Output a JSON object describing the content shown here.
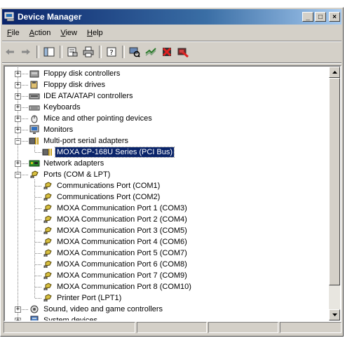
{
  "window": {
    "title": "Device Manager",
    "minimize_label": "_",
    "maximize_label": "□",
    "close_label": "×"
  },
  "menu": [
    {
      "key": "F",
      "rest": "ile"
    },
    {
      "key": "A",
      "rest": "ction"
    },
    {
      "key": "V",
      "rest": "iew"
    },
    {
      "key": "H",
      "rest": "elp"
    }
  ],
  "toolbar": {
    "icons": [
      "back-arrow-icon",
      "forward-arrow-icon",
      "show-hide-console-tree-icon",
      "properties-icon",
      "print-icon",
      "help-icon",
      "scan-hardware-icon",
      "update-driver-icon",
      "uninstall-icon",
      "disable-icon"
    ]
  },
  "tree": {
    "items": [
      {
        "label": "Floppy disk controllers",
        "icon": "floppy-controller-icon",
        "expander": "+"
      },
      {
        "label": "Floppy disk drives",
        "icon": "floppy-drive-icon",
        "expander": "+"
      },
      {
        "label": "IDE ATA/ATAPI controllers",
        "icon": "ide-controller-icon",
        "expander": "+"
      },
      {
        "label": "Keyboards",
        "icon": "keyboard-icon",
        "expander": "+"
      },
      {
        "label": "Mice and other pointing devices",
        "icon": "mouse-icon",
        "expander": "+"
      },
      {
        "label": "Monitors",
        "icon": "monitor-icon",
        "expander": "+"
      },
      {
        "label": "Multi-port serial adapters",
        "icon": "serial-adapter-icon",
        "expander": "−"
      },
      {
        "label": "MOXA CP-168U Series (PCI Bus)",
        "icon": "serial-adapter-icon",
        "selected": true
      },
      {
        "label": "Network adapters",
        "icon": "network-adapter-icon",
        "expander": "+"
      },
      {
        "label": "Ports (COM & LPT)",
        "icon": "port-icon",
        "expander": "−"
      },
      {
        "label": "Communications Port (COM1)",
        "icon": "port-icon"
      },
      {
        "label": "Communications Port (COM2)",
        "icon": "port-icon"
      },
      {
        "label": "MOXA Communication Port 1 (COM3)",
        "icon": "port-icon"
      },
      {
        "label": "MOXA Communication Port 2 (COM4)",
        "icon": "port-icon"
      },
      {
        "label": "MOXA Communication Port 3 (COM5)",
        "icon": "port-icon"
      },
      {
        "label": "MOXA Communication Port 4 (COM6)",
        "icon": "port-icon"
      },
      {
        "label": "MOXA Communication Port 5 (COM7)",
        "icon": "port-icon"
      },
      {
        "label": "MOXA Communication Port 6 (COM8)",
        "icon": "port-icon"
      },
      {
        "label": "MOXA Communication Port 7 (COM9)",
        "icon": "port-icon"
      },
      {
        "label": "MOXA Communication Port 8 (COM10)",
        "icon": "port-icon"
      },
      {
        "label": "Printer Port (LPT1)",
        "icon": "port-icon"
      },
      {
        "label": "Sound, video and game controllers",
        "icon": "sound-icon",
        "expander": "+"
      },
      {
        "label": "System devices",
        "icon": "system-devices-icon",
        "expander": "+"
      }
    ]
  },
  "colors": {
    "titlebar": "#0a246a",
    "selection": "#0a246a",
    "face": "#d4d0c8"
  }
}
